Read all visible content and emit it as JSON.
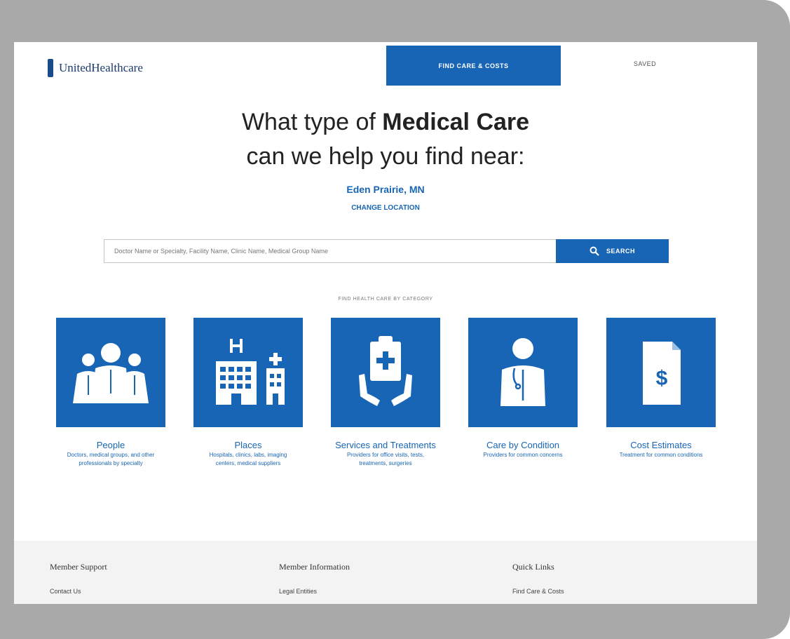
{
  "header": {
    "logo_text": "UnitedHealthcare",
    "nav_find_care": "FIND CARE & COSTS",
    "nav_saved": "SAVED"
  },
  "hero": {
    "headline_line1_pre": "What type of ",
    "headline_line1_bold": "Medical Care",
    "headline_line2": "can we help you find near:",
    "location": "Eden Prairie, MN",
    "change_location": "CHANGE LOCATION"
  },
  "search": {
    "placeholder": "Doctor Name or Specialty, Facility Name, Clinic Name, Medical Group Name",
    "button_label": "SEARCH"
  },
  "categories": {
    "section_label": "FIND HEALTH CARE BY CATEGORY",
    "items": [
      {
        "title": "People",
        "desc_line1": "Doctors, medical groups, and other",
        "desc_line2": "professionals by specialty",
        "icon": "people-icon"
      },
      {
        "title": "Places",
        "desc_line1": "Hospitals, clinics, labs, imaging",
        "desc_line2": "centers, medical suppliers",
        "icon": "building-icon"
      },
      {
        "title": "Services and Treatments",
        "desc_line1": "Providers for office visits, tests,",
        "desc_line2": "treatments, surgeries",
        "icon": "clipboard-hands-icon"
      },
      {
        "title": "Care by Condition",
        "desc_line1": "Providers for common concerns",
        "desc_line2": "",
        "icon": "doctor-icon"
      },
      {
        "title": "Cost Estimates",
        "desc_line1": "Treatment for common conditions",
        "desc_line2": "",
        "icon": "dollar-document-icon"
      }
    ]
  },
  "footer": {
    "col1_heading": "Member Support",
    "col1_link": "Contact Us",
    "col2_heading": "Member Information",
    "col2_link": "Legal Entities",
    "col3_heading": "Quick Links",
    "col3_link": "Find Care & Costs"
  },
  "colors": {
    "brand_blue": "#1865b5",
    "device_frame": "#a9a9a9",
    "footer_bg": "#f3f3f3"
  }
}
